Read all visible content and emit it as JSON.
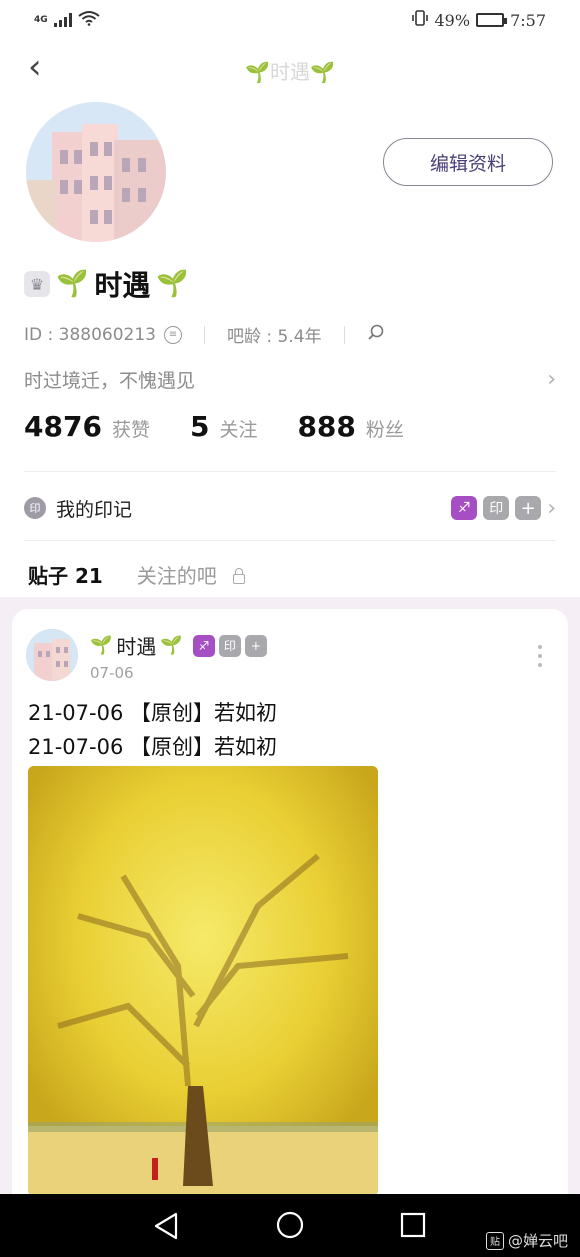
{
  "status_bar": {
    "network": "4G",
    "battery_pct_label": "49%",
    "battery_level": 0.49,
    "time": "7:57"
  },
  "header": {
    "back_icon": "chevron-left-icon",
    "title": "🌱时遇🌱"
  },
  "profile": {
    "edit_button": "编辑资料",
    "name": "时遇",
    "id_text": "ID : 388060213",
    "bar_age": "吧龄 : 5.4年",
    "bio": "时过境迁，不愧遇见",
    "stats": [
      {
        "num": "4876",
        "label": "获赞"
      },
      {
        "num": "5",
        "label": "关注"
      },
      {
        "num": "888",
        "label": "粉丝"
      }
    ]
  },
  "marks": {
    "icon_text": "印",
    "label": "我的印记",
    "badges": [
      "♐",
      "印",
      "+"
    ]
  },
  "tabs": [
    {
      "label": "贴子 21",
      "active": true
    },
    {
      "label": "关注的吧",
      "active": false
    }
  ],
  "post": {
    "author": "时遇",
    "date": "07-06",
    "badges": [
      "♐",
      "印",
      "+"
    ],
    "lines": [
      "21-07-06 【原创】若如初",
      "21-07-06 【原创】若如初"
    ]
  },
  "watermark": {
    "box": "贴",
    "text": "@婵云吧"
  },
  "colors": {
    "accent": "#6a5acd",
    "badge_purple": "#a64fc4",
    "badge_grey": "#a8a8ad",
    "feed_bg": "#f5eff5"
  }
}
